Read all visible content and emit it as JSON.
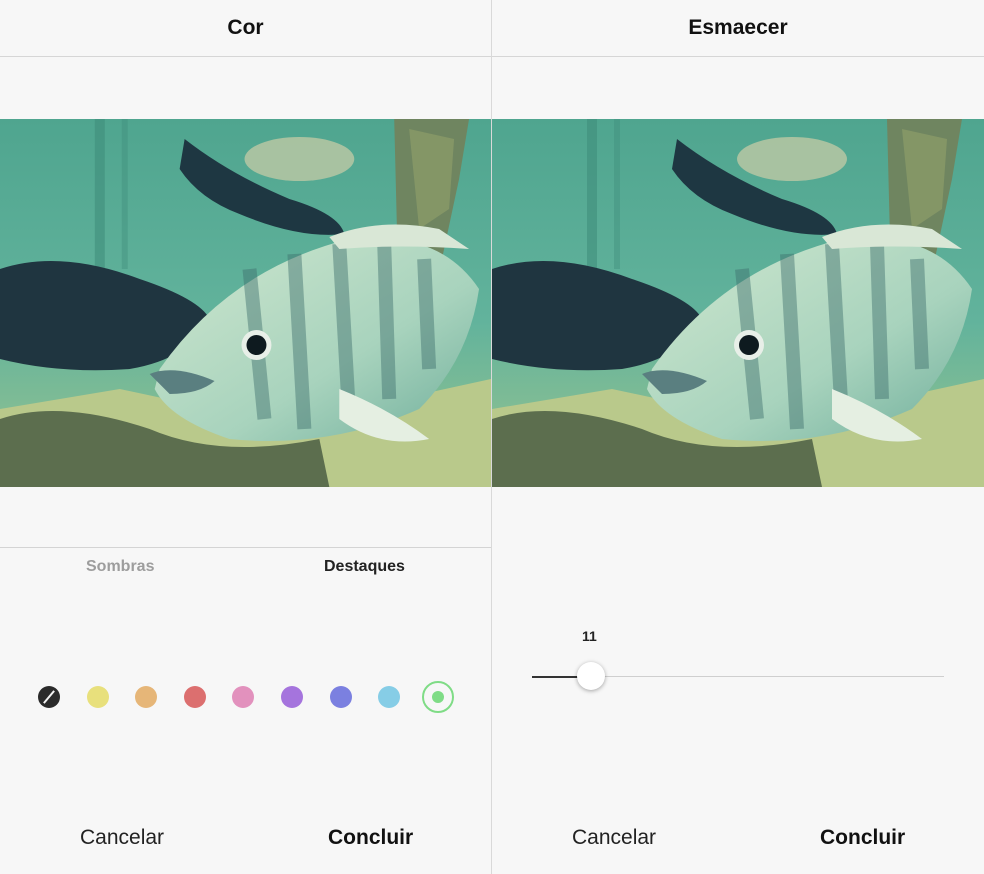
{
  "color_panel": {
    "title": "Cor",
    "tabs": [
      {
        "label": "Sombras",
        "active": false
      },
      {
        "label": "Destaques",
        "active": true
      }
    ],
    "swatches": [
      {
        "icon": "no-color",
        "color": "#2b2b2b",
        "selected": false
      },
      {
        "color": "#e8e07c",
        "selected": false
      },
      {
        "color": "#e6b678",
        "selected": false
      },
      {
        "color": "#dc6f6f",
        "selected": false
      },
      {
        "color": "#e291bd",
        "selected": false
      },
      {
        "color": "#a574dd",
        "selected": false
      },
      {
        "color": "#7b80e0",
        "selected": false
      },
      {
        "color": "#86cde6",
        "selected": false
      },
      {
        "color": "#7fdc86",
        "selected": true
      }
    ],
    "cancel_label": "Cancelar",
    "done_label": "Concluir"
  },
  "fade_panel": {
    "title": "Esmaecer",
    "slider_value": "11",
    "cancel_label": "Cancelar",
    "done_label": "Concluir"
  },
  "photo": {
    "subject_icon": "fish-photo"
  }
}
